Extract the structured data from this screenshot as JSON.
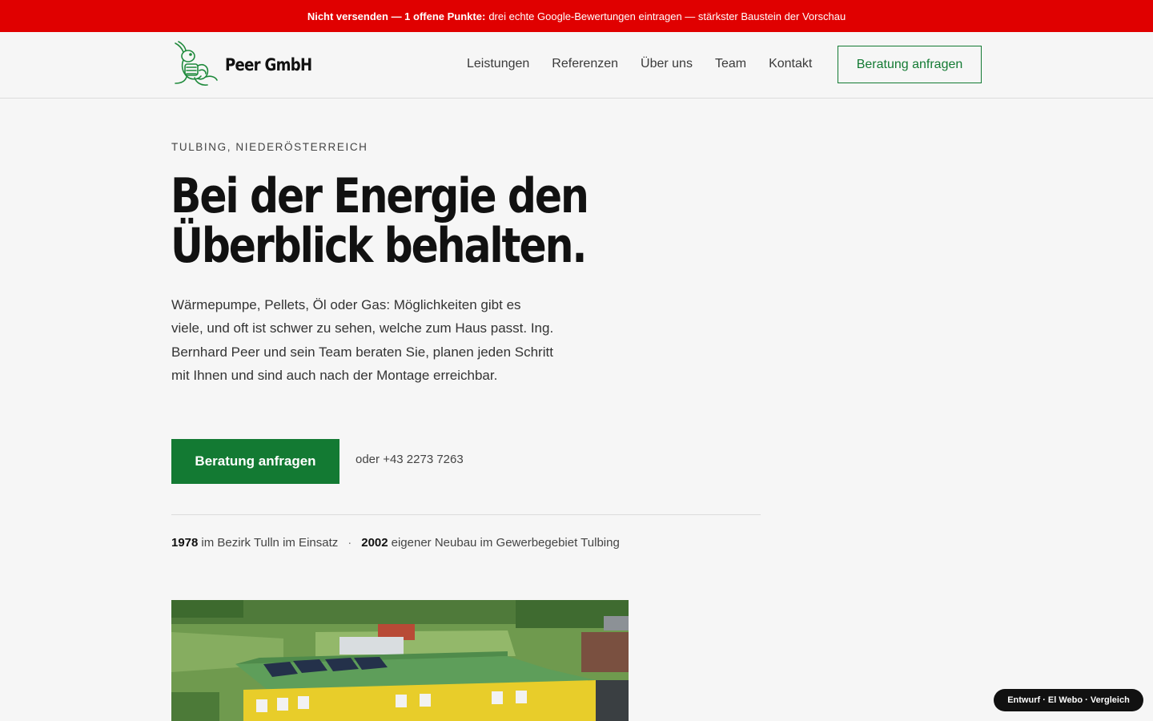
{
  "banner": {
    "strong": "Nicht versenden — 1 offene Punkte:",
    "text": "drei echte Google-Bewertungen eintragen — stärkster Baustein der Vorschau"
  },
  "header": {
    "brand": "Peer GmbH",
    "nav": [
      "Leistungen",
      "Referenzen",
      "Über uns",
      "Team",
      "Kontakt"
    ],
    "cta": "Beratung anfragen"
  },
  "hero": {
    "eyebrow": "Tulbing, Niederösterreich",
    "headline": "Bei der Energie den Überblick behalten.",
    "lead": "Wärmepumpe, Pellets, Öl oder Gas: Möglichkeiten gibt es viele, und oft ist schwer zu sehen, welche zum Haus passt. Ing. Bernhard Peer und sein Team beraten Sie, planen jeden Schritt mit Ihnen und sind auch nach der Montage erreichbar.",
    "cta": "Beratung anfragen",
    "phone": "oder +43 2273 7263"
  },
  "facts": [
    {
      "year": "1978",
      "text": "im Bezirk Tulln im Einsatz"
    },
    {
      "year": "2002",
      "text": "eigener Neubau im Gewerbegebiet Tulbing"
    }
  ],
  "facts_separator": "·",
  "badge": "Entwurf · El Webo · Vergleich",
  "colors": {
    "banner": "#e00000",
    "accent": "#137a33",
    "background": "#f6f6f6",
    "text": "#111111"
  }
}
